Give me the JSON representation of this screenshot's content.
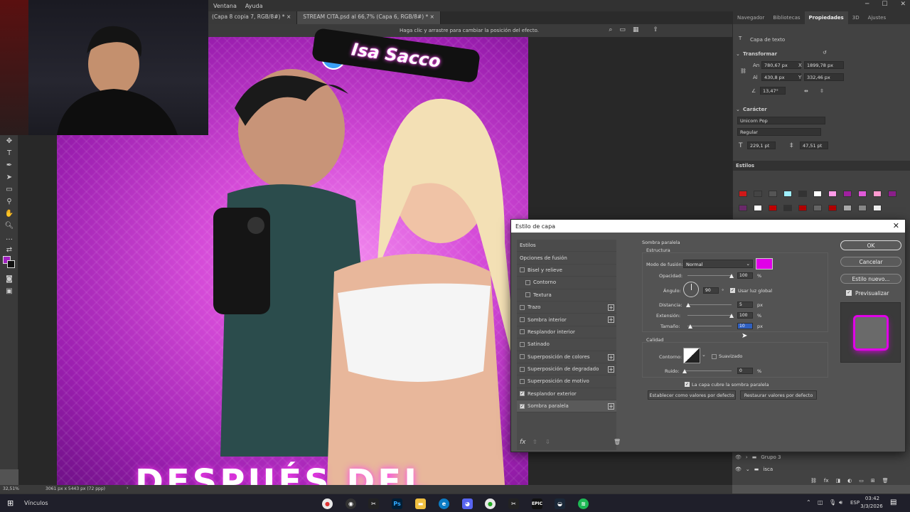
{
  "menu": {
    "items": [
      "Ventana",
      "Ayuda"
    ]
  },
  "tabs": [
    {
      "label": "(Capa 8 copia 7, RGB/8#) *"
    },
    {
      "label": "STREAM CITA.psd al 66,7% (Capa 6, RGB/8#) *"
    }
  ],
  "optbar": {
    "hint": "Haga clic y arrastre para cambiar la posición del efecto."
  },
  "artwork": {
    "name_badge": "Isa Sacco",
    "bottom_text": "DESPUÉS DEL"
  },
  "right_panel": {
    "tabs": [
      "Navegador",
      "Bibliotecas",
      "Propiedades",
      "3D",
      "Ajustes"
    ],
    "layer_kind": "Capa de texto",
    "transform_title": "Transformar",
    "an_label": "An",
    "an_value": "780,67 px",
    "x_label": "X",
    "x_value": "1899,78 px",
    "al_label": "Al",
    "al_value": "430,8 px",
    "y_label": "Y",
    "y_value": "332,46 px",
    "angle_value": "13,47°",
    "character_title": "Carácter",
    "font_family": "Unicorn Pop",
    "font_style": "Regular",
    "font_size": "229,1 pt",
    "leading": "47,51 pt",
    "styles_title": "Estilos"
  },
  "dialog": {
    "title": "Estilo de capa",
    "styles": [
      {
        "label": "Estilos",
        "checkbox": false,
        "checked": false,
        "plus": false,
        "selected": false
      },
      {
        "label": "Opciones de fusión",
        "checkbox": false,
        "checked": false,
        "plus": false,
        "selected": false
      },
      {
        "label": "Bisel y relieve",
        "checkbox": true,
        "checked": false,
        "plus": false,
        "selected": false
      },
      {
        "label": "Contorno",
        "checkbox": true,
        "checked": false,
        "plus": false,
        "selected": false,
        "indent": true
      },
      {
        "label": "Textura",
        "checkbox": true,
        "checked": false,
        "plus": false,
        "selected": false,
        "indent": true
      },
      {
        "label": "Trazo",
        "checkbox": true,
        "checked": false,
        "plus": true,
        "selected": false
      },
      {
        "label": "Sombra interior",
        "checkbox": true,
        "checked": false,
        "plus": true,
        "selected": false
      },
      {
        "label": "Resplandor interior",
        "checkbox": true,
        "checked": false,
        "plus": false,
        "selected": false
      },
      {
        "label": "Satinado",
        "checkbox": true,
        "checked": false,
        "plus": false,
        "selected": false
      },
      {
        "label": "Superposición de colores",
        "checkbox": true,
        "checked": false,
        "plus": true,
        "selected": false
      },
      {
        "label": "Superposición de degradado",
        "checkbox": true,
        "checked": false,
        "plus": true,
        "selected": false
      },
      {
        "label": "Superposición de motivo",
        "checkbox": true,
        "checked": false,
        "plus": false,
        "selected": false
      },
      {
        "label": "Resplandor exterior",
        "checkbox": true,
        "checked": true,
        "plus": false,
        "selected": false
      },
      {
        "label": "Sombra paralela",
        "checkbox": true,
        "checked": true,
        "plus": true,
        "selected": true
      }
    ],
    "section_title": "Sombra paralela",
    "structure_title": "Estructura",
    "blend_label": "Modo de fusión:",
    "blend_value": "Normal",
    "shadow_color": "#e000e8",
    "opacity_label": "Opacidad:",
    "opacity_value": "100",
    "opacity_unit": "%",
    "opacity_fraction": 1.0,
    "angle_label": "Ángulo:",
    "angle_value": "90",
    "angle_unit": "°",
    "global_light_label": "Usar luz global",
    "distance_label": "Distancia:",
    "distance_value": "5",
    "distance_unit": "px",
    "distance_fraction": 0.02,
    "spread_label": "Extensión:",
    "spread_value": "100",
    "spread_unit": "%",
    "spread_fraction": 1.0,
    "size_label": "Tamaño:",
    "size_value": "10",
    "size_unit": "px",
    "size_fraction": 0.07,
    "quality_title": "Calidad",
    "contour_label": "Contorno:",
    "antialias_label": "Suavizado",
    "noise_label": "Ruido:",
    "noise_value": "0",
    "noise_unit": "%",
    "noise_fraction": 0.0,
    "knockout_label": "La capa cubre la sombra paralela",
    "set_default_button": "Establecer como valores por defecto",
    "reset_default_button": "Restaurar valores por defecto",
    "ok_button": "OK",
    "cancel_button": "Cancelar",
    "new_style_button": "Estilo nuevo...",
    "preview_label": "Previsualizar"
  },
  "layers": [
    {
      "name": "Grupo 3"
    },
    {
      "name": "isca"
    }
  ],
  "statusbar": {
    "zoom": "32,51%",
    "doc_info": "3061 px x 5443 px (72 ppp)"
  },
  "taskbar": {
    "weather_label": "Vínculos",
    "language": "ESP",
    "time": "03:42",
    "date": "3/3/2026"
  },
  "colors": {
    "accent_pink": "#e000e8",
    "panel_bg": "#535353"
  }
}
